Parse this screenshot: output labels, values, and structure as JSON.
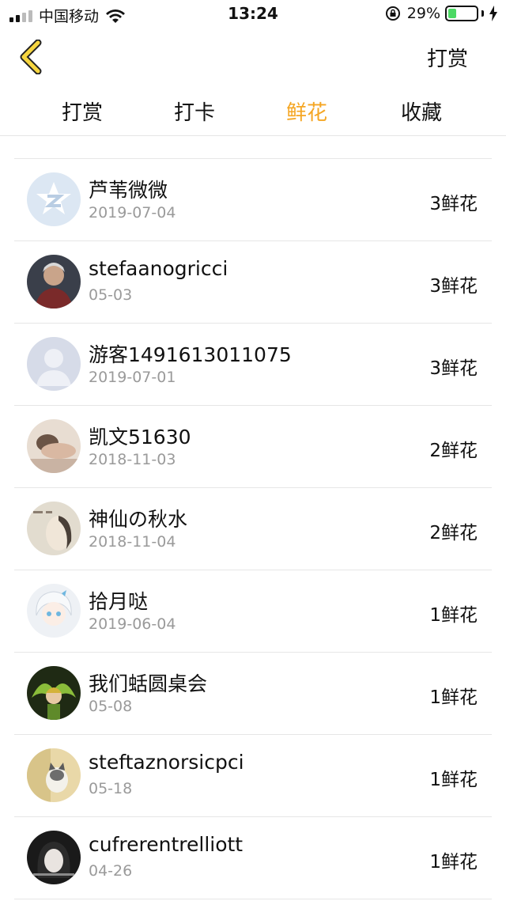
{
  "status_bar": {
    "carrier": "中国移动",
    "time": "13:24",
    "battery_percent": "29%",
    "battery_level": 0.29,
    "signal_bars": 2
  },
  "nav": {
    "right_label": "打赏"
  },
  "tabs": [
    {
      "label": "打赏",
      "active": false
    },
    {
      "label": "打卡",
      "active": false
    },
    {
      "label": "鲜花",
      "active": true
    },
    {
      "label": "收藏",
      "active": false
    }
  ],
  "colors": {
    "accent": "#f5a623",
    "battery_green": "#4cd964"
  },
  "list": [
    {
      "name": "芦苇微微",
      "date": "2019-07-04",
      "count": "3鲜花",
      "avatar": "default-z-avatar"
    },
    {
      "name": "stefaanogricci",
      "date": "05-03",
      "count": "3鲜花",
      "avatar": "user-photo-avatar"
    },
    {
      "name": "游客1491613011075",
      "date": "2019-07-01",
      "count": "3鲜花",
      "avatar": "guest-silhouette-avatar"
    },
    {
      "name": "凯文51630",
      "date": "2018-11-03",
      "count": "2鲜花",
      "avatar": "user-photo-avatar"
    },
    {
      "name": "神仙の秋水",
      "date": "2018-11-04",
      "count": "2鲜花",
      "avatar": "user-photo-avatar"
    },
    {
      "name": "拾月哒",
      "date": "2019-06-04",
      "count": "1鲜花",
      "avatar": "anime-avatar"
    },
    {
      "name": "我们蛞圆桌会",
      "date": "05-08",
      "count": "1鲜花",
      "avatar": "user-photo-avatar"
    },
    {
      "name": "steftaznorsicpci",
      "date": "05-18",
      "count": "1鲜花",
      "avatar": "cat-photo-avatar"
    },
    {
      "name": "cufrerentrelliott",
      "date": "04-26",
      "count": "1鲜花",
      "avatar": "user-photo-avatar"
    }
  ]
}
